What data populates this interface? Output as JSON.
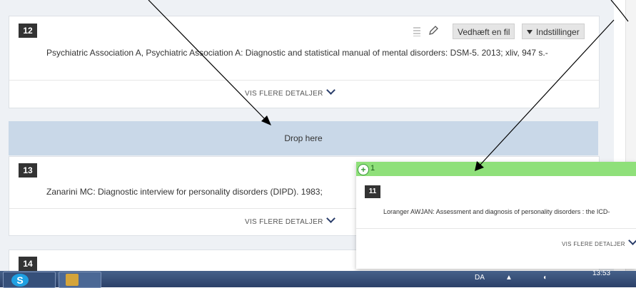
{
  "items": [
    {
      "number": "12",
      "reference": "Psychiatric Association A, Psychiatric Association A: Diagnostic and statistical manual of mental disorders: DSM-5. 2013; xliv, 947 s.-",
      "attach_label": "Vedhæft en fil",
      "settings_label": "Indstillinger",
      "more_label": "VIS FLERE DETALJER"
    },
    {
      "number": "13",
      "reference": "Zanarini MC: Diagnostic interview for personality disorders (DIPD). 1983;",
      "more_label": "VIS FLERE DETALJER"
    },
    {
      "number": "14"
    }
  ],
  "drop_zone": {
    "label": "Drop here"
  },
  "dragged_item": {
    "count": "1",
    "number": "11",
    "reference": "Loranger AWJAN: Assessment and diagnosis of personality disorders : the ICD-",
    "more_label": "VIS FLERE DETALJER"
  },
  "taskbar": {
    "language": "DA",
    "time": "13:53"
  },
  "colors": {
    "drop_zone": "#c9d8e8",
    "drag_header": "#8fe07a",
    "badge": "#333333",
    "button": "#e5e5e5"
  }
}
